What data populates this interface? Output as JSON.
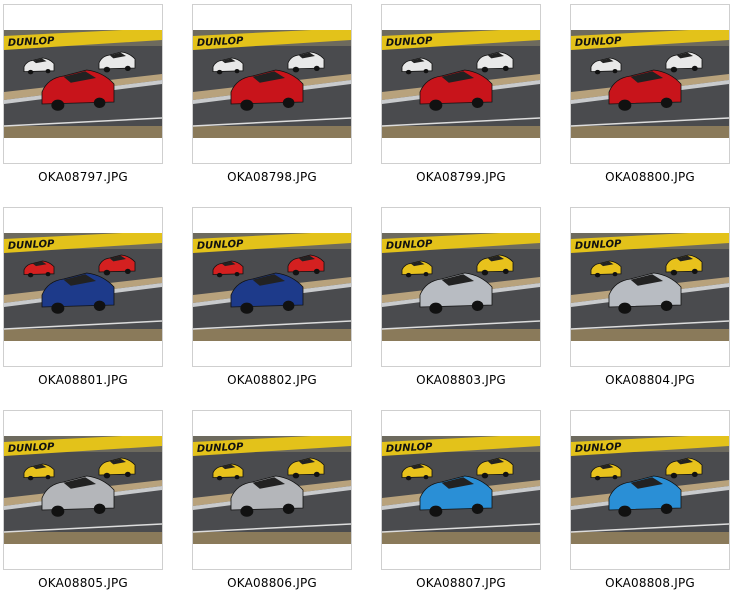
{
  "gallery": {
    "items": [
      {
        "filename": "OKA08797.JPG",
        "car": "red-sports-car-icon",
        "car_color": "#c8141b",
        "bg_cars": "white",
        "banner_text": "DUNLOP"
      },
      {
        "filename": "OKA08798.JPG",
        "car": "red-sports-car-icon",
        "car_color": "#c8141b",
        "bg_cars": "white",
        "banner_text": "DUNLOP"
      },
      {
        "filename": "OKA08799.JPG",
        "car": "red-sports-car-icon",
        "car_color": "#c8141b",
        "bg_cars": "white",
        "banner_text": "DUNLOP"
      },
      {
        "filename": "OKA08800.JPG",
        "car": "red-sports-car-icon",
        "car_color": "#c8141b",
        "bg_cars": "white",
        "banner_text": "DUNLOP"
      },
      {
        "filename": "OKA08801.JPG",
        "car": "blue-sedan-icon",
        "car_color": "#1d3a8a",
        "bg_cars": "red",
        "banner_text": "DUNLOP"
      },
      {
        "filename": "OKA08802.JPG",
        "car": "blue-sedan-icon",
        "car_color": "#1d3a8a",
        "bg_cars": "red",
        "banner_text": "DUNLOP"
      },
      {
        "filename": "OKA08803.JPG",
        "car": "silver-gtr-icon",
        "car_color": "#b8bcc2",
        "bg_cars": "yellow",
        "banner_text": "DUNLOP"
      },
      {
        "filename": "OKA08804.JPG",
        "car": "silver-gtr-icon",
        "car_color": "#b8bcc2",
        "bg_cars": "yellow",
        "banner_text": "DUNLOP"
      },
      {
        "filename": "OKA08805.JPG",
        "car": "silver-coupe-icon",
        "car_color": "#b4b6ba",
        "bg_cars": "yellow",
        "banner_text": "DUNLOP"
      },
      {
        "filename": "OKA08806.JPG",
        "car": "silver-coupe-icon",
        "car_color": "#b4b6ba",
        "bg_cars": "yellow",
        "banner_text": "DUNLOP"
      },
      {
        "filename": "OKA08807.JPG",
        "car": "blue-livery-car-icon",
        "car_color": "#2a8fd6",
        "bg_cars": "yellow",
        "banner_text": "DUNLOP"
      },
      {
        "filename": "OKA08808.JPG",
        "car": "blue-livery-car-icon",
        "car_color": "#2a8fd6",
        "bg_cars": "yellow",
        "banner_text": "DUNLOP"
      }
    ]
  }
}
